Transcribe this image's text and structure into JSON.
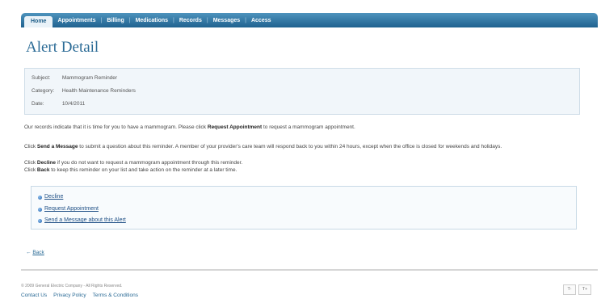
{
  "nav": {
    "items": [
      {
        "label": "Home",
        "active": true
      },
      {
        "label": "Appointments",
        "active": false
      },
      {
        "label": "Billing",
        "active": false
      },
      {
        "label": "Medications",
        "active": false
      },
      {
        "label": "Records",
        "active": false
      },
      {
        "label": "Messages",
        "active": false
      },
      {
        "label": "Access",
        "active": false
      }
    ]
  },
  "page": {
    "title": "Alert Detail"
  },
  "details": {
    "subject": {
      "label": "Subject:",
      "value": "Mammogram Reminder"
    },
    "category": {
      "label": "Category:",
      "value": "Health Maintenance Reminders"
    },
    "date": {
      "label": "Date:",
      "value": "10/4/2011"
    }
  },
  "body": {
    "p1_pre": "Our records indicate that it is time for you to have a mammogram. Please click ",
    "p1_bold": "Request Appointment",
    "p1_post": " to request a mammogram appointment.",
    "p2_pre": "Click ",
    "p2_bold": "Send a Message",
    "p2_post": " to submit a question about this reminder. A member of your provider's care team will respond back to you within 24 hours, except when the office is closed for weekends and holidays.",
    "p3_pre": "Click ",
    "p3_bold": "Decline",
    "p3_post": " if you do not want to request a mammogram appointment through this reminder.",
    "p4_pre": "Click ",
    "p4_bold": "Back",
    "p4_post": " to keep this reminder on your list and take action on the reminder at a later time."
  },
  "actions": {
    "decline": "Decline",
    "request": "Request Appointment",
    "message": "Send a Message about this Alert"
  },
  "back": {
    "arrow": "←",
    "label": "Back"
  },
  "footer": {
    "copyright": "© 2009 General Electric Company - All Rights Reserved.",
    "links": [
      "Contact Us",
      "Privacy Policy",
      "Terms & Conditions"
    ],
    "text_smaller": "T-",
    "text_larger": "T+"
  }
}
